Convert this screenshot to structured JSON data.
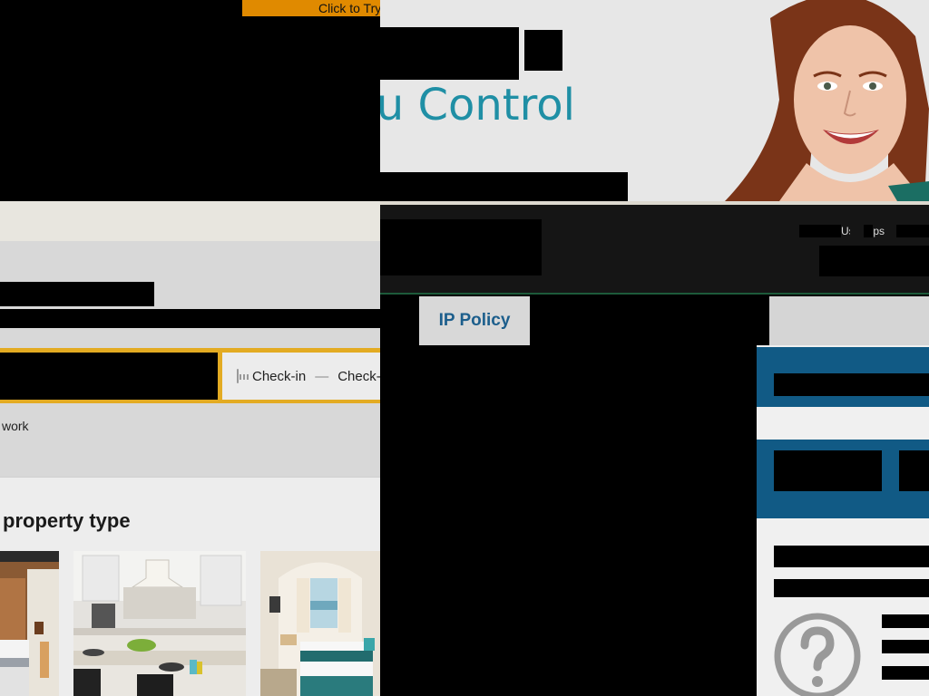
{
  "promo": {
    "try_label": "Click to Try"
  },
  "booking": {
    "checkin_label": "Check-in",
    "date_separator": "—",
    "checkout_label": "Check-out",
    "work_label": "work",
    "property_heading": "property type"
  },
  "support": {
    "tagline": "ou Control",
    "nav_link_1": "Us",
    "nav_link_2": "ps",
    "tab_ip_policy": "IP Policy"
  },
  "colors": {
    "promo_orange": "#e08a00",
    "search_border": "#e3ab22",
    "tagline_teal": "#1f8fa5",
    "sidebar_blue": "#115a85",
    "tab_text_blue": "#1c5e8c"
  },
  "icons": [
    "calendar-icon",
    "help-question-icon"
  ]
}
